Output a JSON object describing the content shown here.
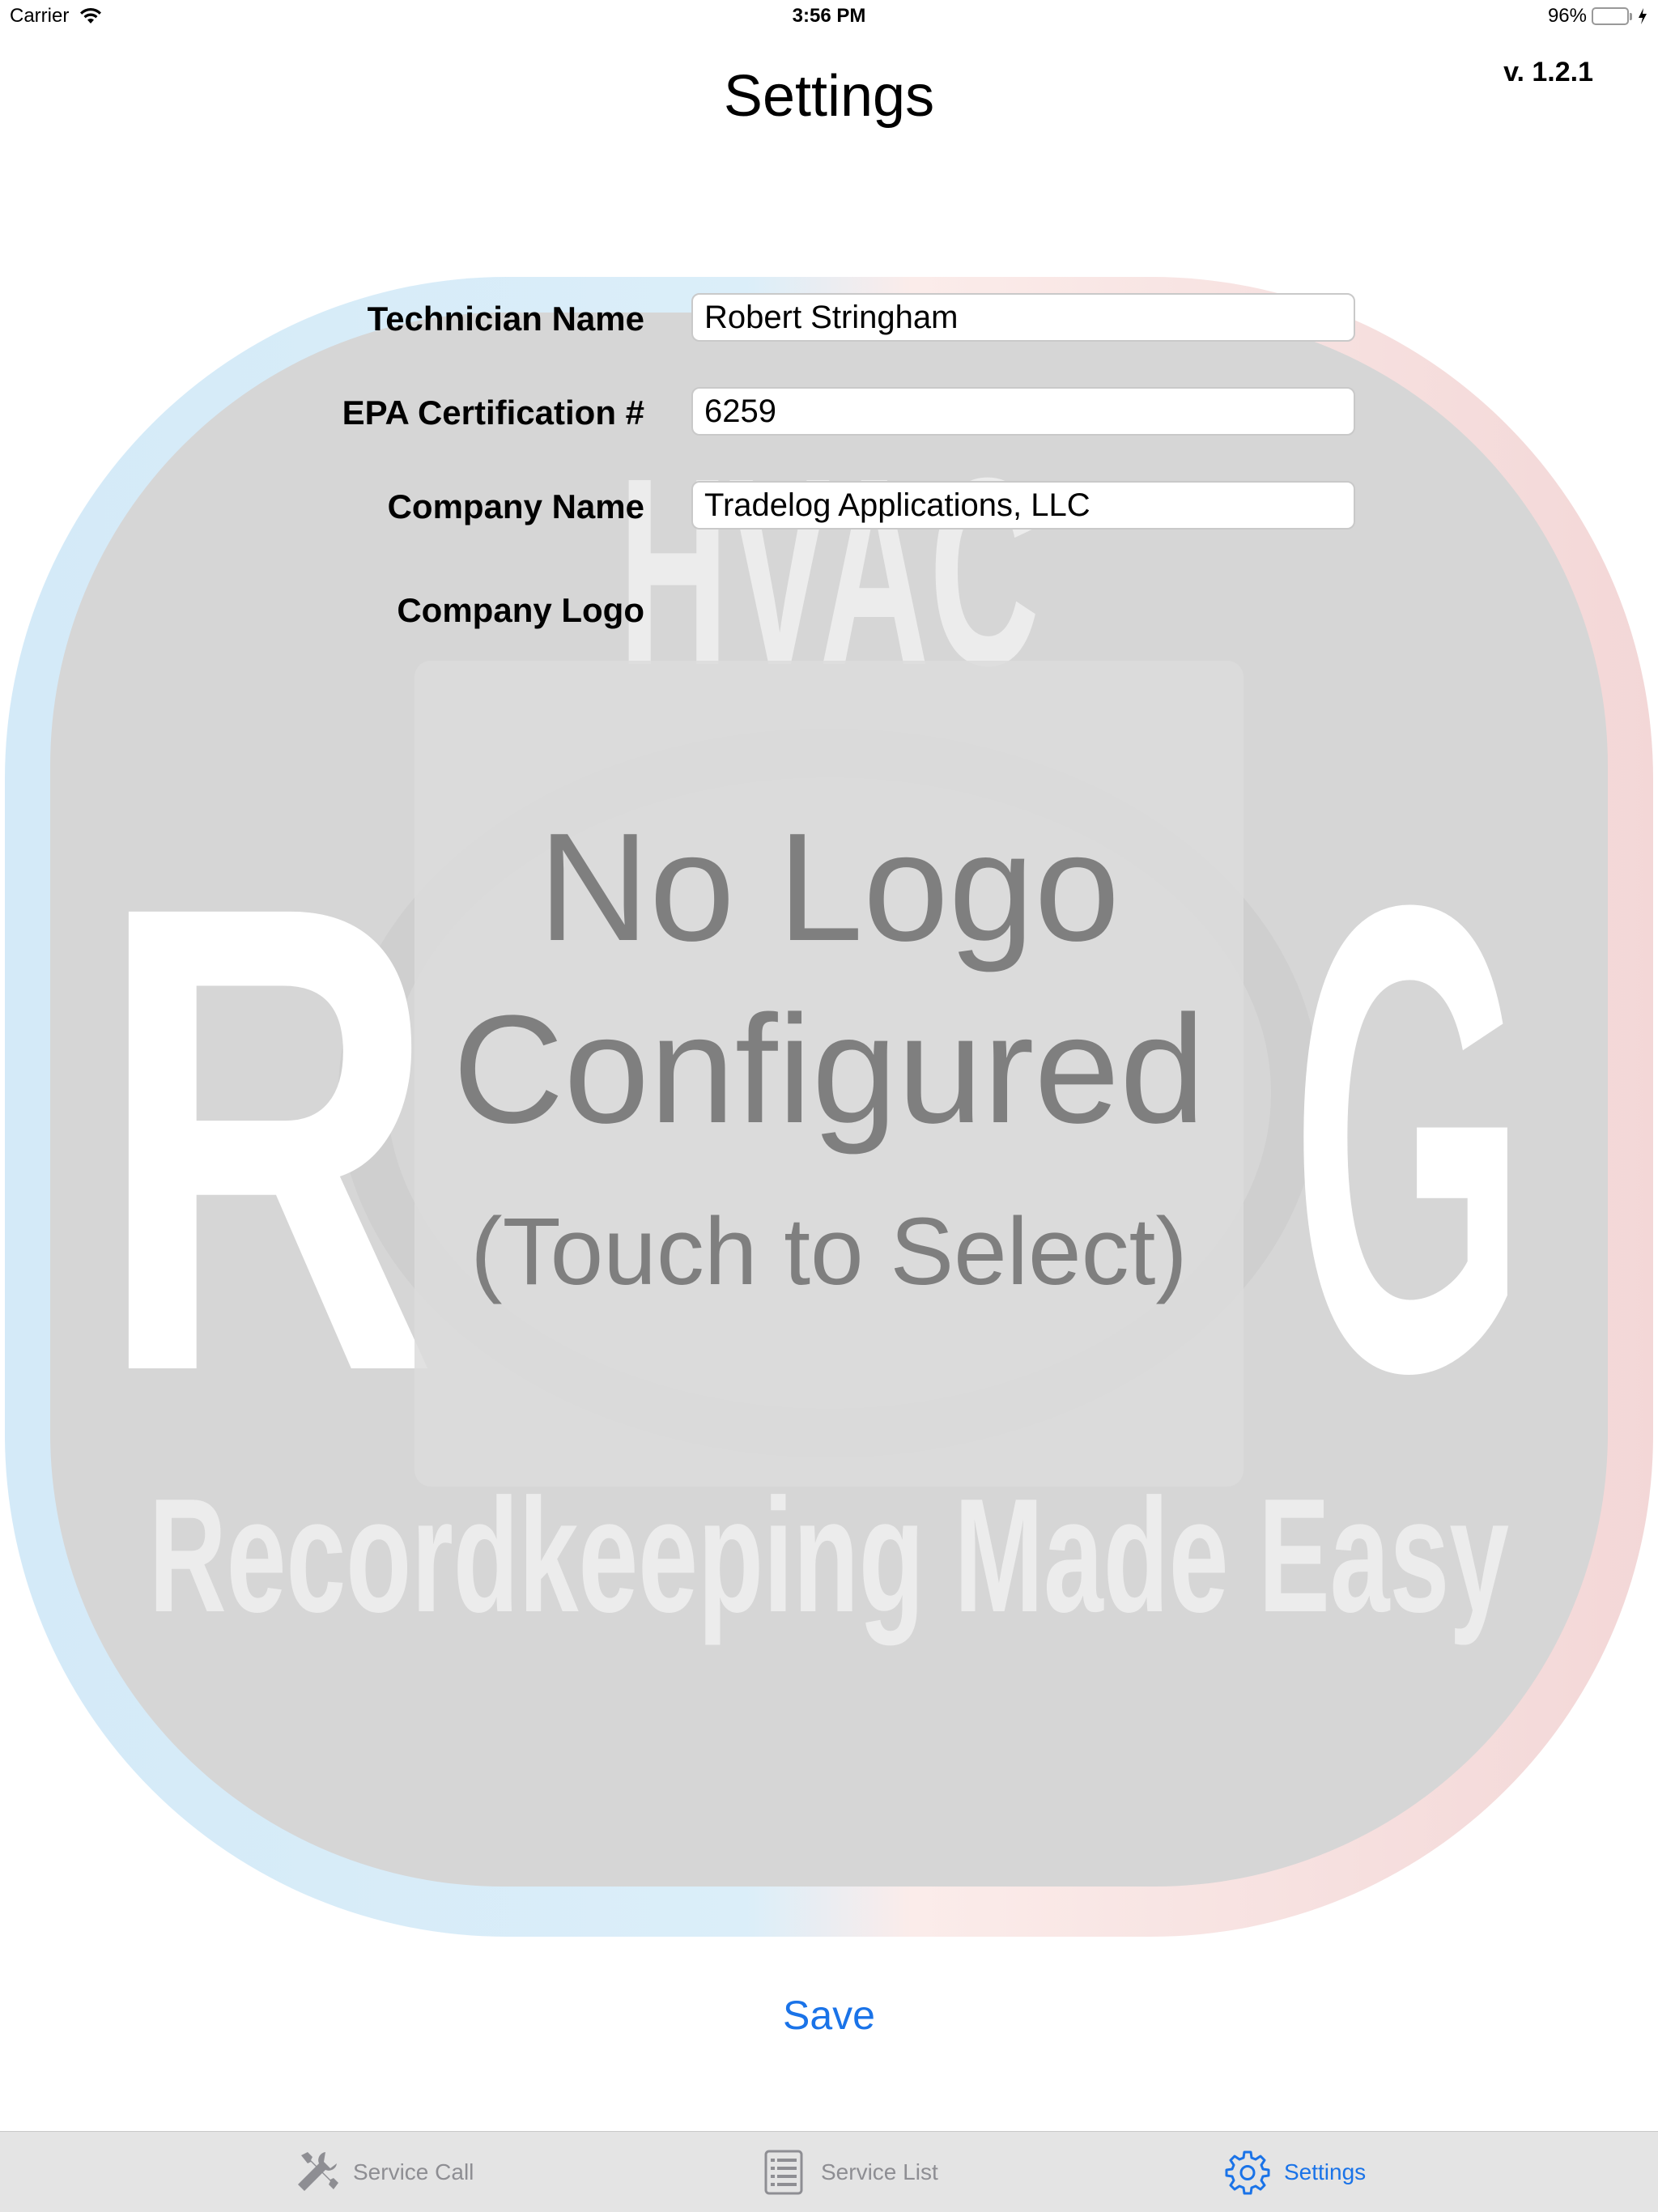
{
  "status_bar": {
    "carrier": "Carrier",
    "time": "3:56 PM",
    "battery_percent": "96%",
    "battery_level": 0.96
  },
  "header": {
    "title": "Settings",
    "version": "v. 1.2.1"
  },
  "form": {
    "technician_name": {
      "label": "Technician Name",
      "value": "Robert Stringham"
    },
    "epa_cert": {
      "label": "EPA Certification #",
      "value": "6259"
    },
    "company_name": {
      "label": "Company Name",
      "value": "Tradelog Applications, LLC"
    },
    "company_logo": {
      "label": "Company Logo"
    }
  },
  "logo_picker": {
    "line1": "No Logo",
    "line2": "Configured",
    "line3": "(Touch to Select)"
  },
  "watermark": {
    "top": "HVAC",
    "left_letter": "R",
    "right_letter": "G",
    "tagline": "Recordkeeping Made Easy"
  },
  "actions": {
    "save_label": "Save"
  },
  "tab_bar": {
    "tabs": [
      {
        "label": "Service Call",
        "icon": "tools-icon",
        "active": false
      },
      {
        "label": "Service List",
        "icon": "list-icon",
        "active": false
      },
      {
        "label": "Settings",
        "icon": "gear-icon",
        "active": true
      }
    ]
  },
  "colors": {
    "accent": "#1a73e8",
    "placeholder_text": "#7f7f7f",
    "tab_bar_bg": "#e4e4e4",
    "battery": "#4cd964"
  }
}
